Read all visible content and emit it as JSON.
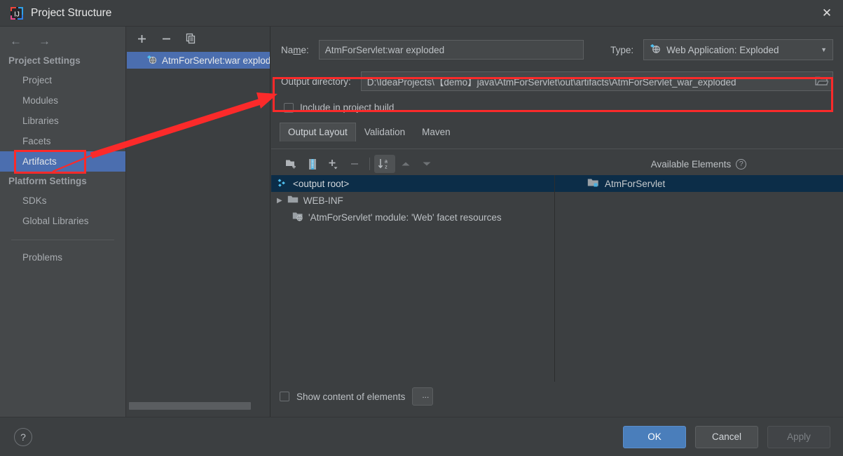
{
  "window": {
    "title": "Project Structure",
    "app_icon": "intellij-idea-icon",
    "close_icon": "✕"
  },
  "sidebar": {
    "nav": {
      "back_icon": "←",
      "forward_icon": "→"
    },
    "groups": [
      {
        "label": "Project Settings",
        "items": [
          {
            "label": "Project",
            "selected": false
          },
          {
            "label": "Modules",
            "selected": false
          },
          {
            "label": "Libraries",
            "selected": false
          },
          {
            "label": "Facets",
            "selected": false
          },
          {
            "label": "Artifacts",
            "selected": true
          }
        ]
      },
      {
        "label": "Platform Settings",
        "items": [
          {
            "label": "SDKs",
            "selected": false
          },
          {
            "label": "Global Libraries",
            "selected": false
          }
        ]
      }
    ],
    "problems": {
      "label": "Problems"
    }
  },
  "artifacts_panel": {
    "toolbar": [
      {
        "name": "add-artifact-button",
        "glyph": "+"
      },
      {
        "name": "remove-artifact-button",
        "glyph": "−"
      },
      {
        "name": "copy-artifact-button",
        "glyph": "copy-icon"
      }
    ],
    "items": [
      {
        "label": "AtmForServlet:war exploded",
        "selected": true,
        "icon": "war-exploded-icon"
      }
    ]
  },
  "main": {
    "name_label": "Name:",
    "name_value": "AtmForServlet:war exploded",
    "type_label": "Type:",
    "type_value": "Web Application: Exploded",
    "type_icon": "web-app-exploded-icon",
    "output_dir_label": "Output directory:",
    "output_dir_value": "D:\\IdeaProjects\\【demo】java\\AtmForServlet\\out\\artifacts\\AtmForServlet_war_exploded",
    "browse_icon": "folder-open-icon",
    "include_in_build_label": "Include in project build",
    "include_in_build_checked": false,
    "tabs": [
      {
        "label": "Output Layout",
        "active": true
      },
      {
        "label": "Validation",
        "active": false
      },
      {
        "label": "Maven",
        "active": false
      }
    ],
    "layout_toolbar": [
      {
        "name": "create-directory-button",
        "icon": "new-folder-icon",
        "state": "enabled"
      },
      {
        "name": "create-archive-button",
        "icon": "archive-icon",
        "state": "enabled"
      },
      {
        "name": "add-copy-of-button",
        "icon": "plus-dropdown-icon",
        "state": "enabled"
      },
      {
        "name": "remove-element-button",
        "icon": "minus-icon",
        "state": "disabled"
      },
      {
        "name": "sort-elements-button",
        "icon": "sort-az-icon",
        "state": "active"
      },
      {
        "name": "move-up-button",
        "icon": "triangle-up-icon",
        "state": "disabled"
      },
      {
        "name": "move-down-button",
        "icon": "triangle-down-icon",
        "state": "disabled"
      }
    ],
    "available_elements_label": "Available Elements",
    "available_help_icon": "?",
    "output_tree": [
      {
        "label": "<output root>",
        "icon": "artifact-root-icon",
        "indent": 1,
        "selected": true,
        "expander": ""
      },
      {
        "label": "WEB-INF",
        "icon": "folder-icon",
        "indent": 2,
        "selected": false,
        "expander": "▶"
      },
      {
        "label": "'AtmForServlet' module: 'Web' facet resources",
        "icon": "web-facet-icon",
        "indent": 3,
        "selected": false,
        "expander": ""
      }
    ],
    "available_tree": [
      {
        "label": "AtmForServlet",
        "icon": "module-icon",
        "selected": true
      }
    ],
    "show_content_label": "Show content of elements",
    "show_content_checked": false,
    "ellipsis_button_label": "..."
  },
  "footer": {
    "help_label": "?",
    "ok_label": "OK",
    "cancel_label": "Cancel",
    "apply_label": "Apply"
  },
  "annotations": {
    "color": "#fb2a2a",
    "boxes": [
      {
        "name": "artifacts-highlight"
      },
      {
        "name": "output-directory-highlight"
      }
    ],
    "arrow": {
      "name": "pointer-arrow",
      "from": "artifacts-highlight",
      "to": "output-directory-highlight"
    }
  }
}
